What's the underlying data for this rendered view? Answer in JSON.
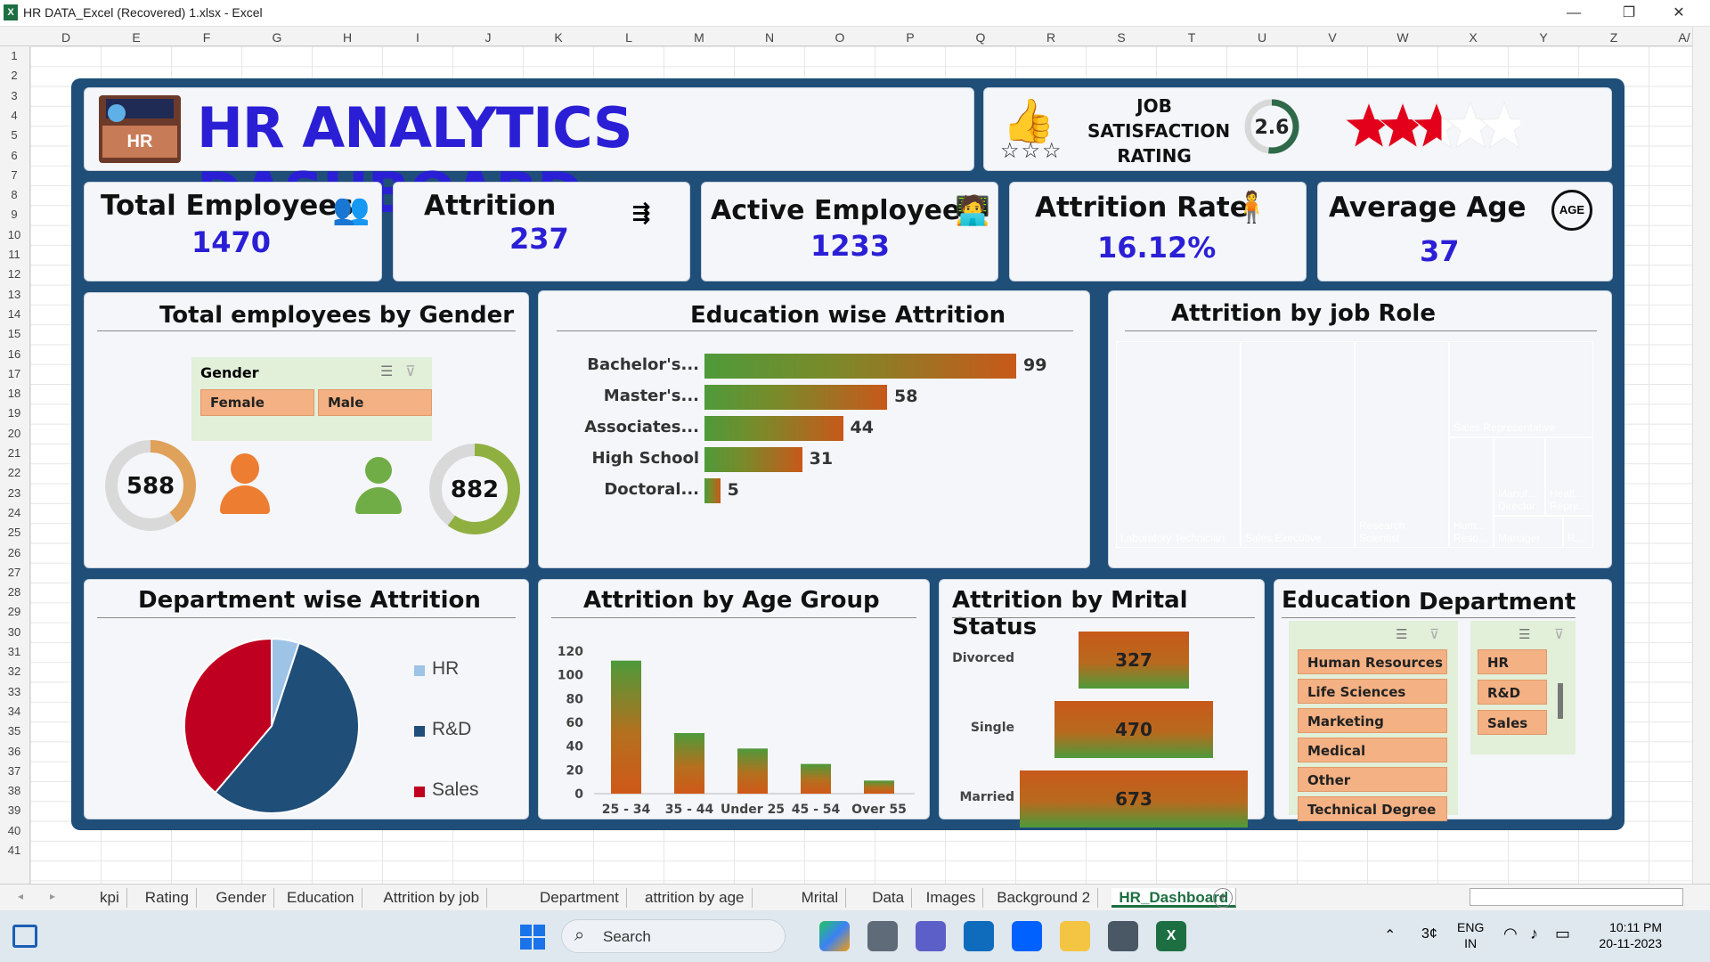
{
  "window": {
    "title": "HR DATA_Excel (Recovered) 1.xlsx - Excel",
    "minimize": "—",
    "restore": "❐",
    "close": "✕"
  },
  "columns": [
    "D",
    "E",
    "F",
    "G",
    "H",
    "I",
    "J",
    "K",
    "L",
    "M",
    "N",
    "O",
    "P",
    "Q",
    "R",
    "S",
    "T",
    "U",
    "V",
    "W",
    "X",
    "Y",
    "Z",
    "A/"
  ],
  "rows": [
    "1",
    "2",
    "3",
    "4",
    "5",
    "6",
    "7",
    "8",
    "9",
    "10",
    "11",
    "12",
    "13",
    "14",
    "15",
    "16",
    "17",
    "18",
    "19",
    "20",
    "21",
    "22",
    "23",
    "24",
    "25",
    "26",
    "27",
    "28",
    "29",
    "30",
    "31",
    "32",
    "33",
    "34",
    "35",
    "36",
    "37",
    "38",
    "39",
    "40",
    "41"
  ],
  "header": {
    "title": "HR ANALYTICS DASHBOARD",
    "logo_text": "HR",
    "rating_label": "JOB SATISFACTION RATING",
    "rating_l1": "JOB",
    "rating_l2": "SATISFACTION",
    "rating_l3": "RATING",
    "rating_value": "2.6",
    "stars_filled": 2.6,
    "stars_total": 5
  },
  "kpis": [
    {
      "label": "Total Employees",
      "value": "1470"
    },
    {
      "label": "Attrition",
      "value": "237"
    },
    {
      "label": "Active Employees",
      "value": "1233"
    },
    {
      "label": "Attrition Rate",
      "value": "16.12%"
    },
    {
      "label": "Average Age",
      "value": "37",
      "icon_text": "AGE"
    }
  ],
  "gender": {
    "title": "Total employees by Gender",
    "slicer_title": "Gender",
    "options": [
      "Female",
      "Male"
    ],
    "female_value": "588",
    "male_value": "882"
  },
  "education_attrition": {
    "title": "Education wise Attrition"
  },
  "jobrole": {
    "title": "Attrition by job Role",
    "items": [
      {
        "label": "Laboratory Technician",
        "color": "#4472c4"
      },
      {
        "label": "Sales Executive",
        "color": "#9e480e"
      },
      {
        "label": "Research Scientist",
        "color": "#264478"
      },
      {
        "label": "Sales Representative",
        "color": "#636363"
      },
      {
        "label": "Hum... Reso...",
        "color": "#ed7d31"
      },
      {
        "label": "Manuf... Director",
        "color": "#5b9bd5"
      },
      {
        "label": "Healt... Repre...",
        "color": "#4472c4"
      },
      {
        "label": "Manager",
        "color": "#ffc000"
      },
      {
        "label": "R...",
        "color": "#70ad47"
      }
    ]
  },
  "department": {
    "title": "Department wise Attrition"
  },
  "agegroup": {
    "title": "Attrition by Age Group"
  },
  "marital": {
    "title": "Attrition by Mrital Status"
  },
  "slicers": {
    "education_title": "Education",
    "department_title": "Department",
    "education_items": [
      "Human Resources",
      "Life Sciences",
      "Marketing",
      "Medical",
      "Other",
      "Technical Degree"
    ],
    "department_items": [
      "HR",
      "R&D",
      "Sales"
    ]
  },
  "sheet_tabs": [
    "kpi",
    "Rating",
    "Gender",
    "Education",
    "Attrition by job",
    "Department",
    "attrition by age",
    "Mrital",
    "Data",
    "Images",
    "Background 2",
    "HR_Dashboard"
  ],
  "active_tab": "HR_Dashboard",
  "taskbar": {
    "search": "Search",
    "lang1": "ENG",
    "lang2": "IN",
    "time": "10:11 PM",
    "date": "20-11-2023",
    "temp": "3¢"
  },
  "chart_data": [
    {
      "type": "bar",
      "title": "Education wise Attrition",
      "categories": [
        "Bachelor's...",
        "Master's...",
        "Associates...",
        "High School",
        "Doctoral..."
      ],
      "values": [
        99,
        58,
        44,
        31,
        5
      ]
    },
    {
      "type": "pie",
      "title": "Department wise Attrition",
      "categories": [
        "HR",
        "R&D",
        "Sales"
      ],
      "values": [
        12,
        133,
        92
      ],
      "colors": [
        "#9dc3e6",
        "#1f4e79",
        "#c00020"
      ]
    },
    {
      "type": "bar",
      "title": "Attrition by Age Group",
      "categories": [
        "25 - 34",
        "35 - 44",
        "Under 25",
        "45 - 54",
        "Over 55"
      ],
      "values": [
        112,
        51,
        38,
        25,
        11
      ],
      "yticks": [
        "120",
        "100",
        "80",
        "60",
        "40",
        "20",
        "0"
      ],
      "ylim": [
        0,
        120
      ]
    },
    {
      "type": "bar",
      "title": "Attrition by Mrital Status",
      "categories": [
        "Divorced",
        "Single",
        "Married"
      ],
      "values": [
        327,
        470,
        673
      ]
    }
  ]
}
